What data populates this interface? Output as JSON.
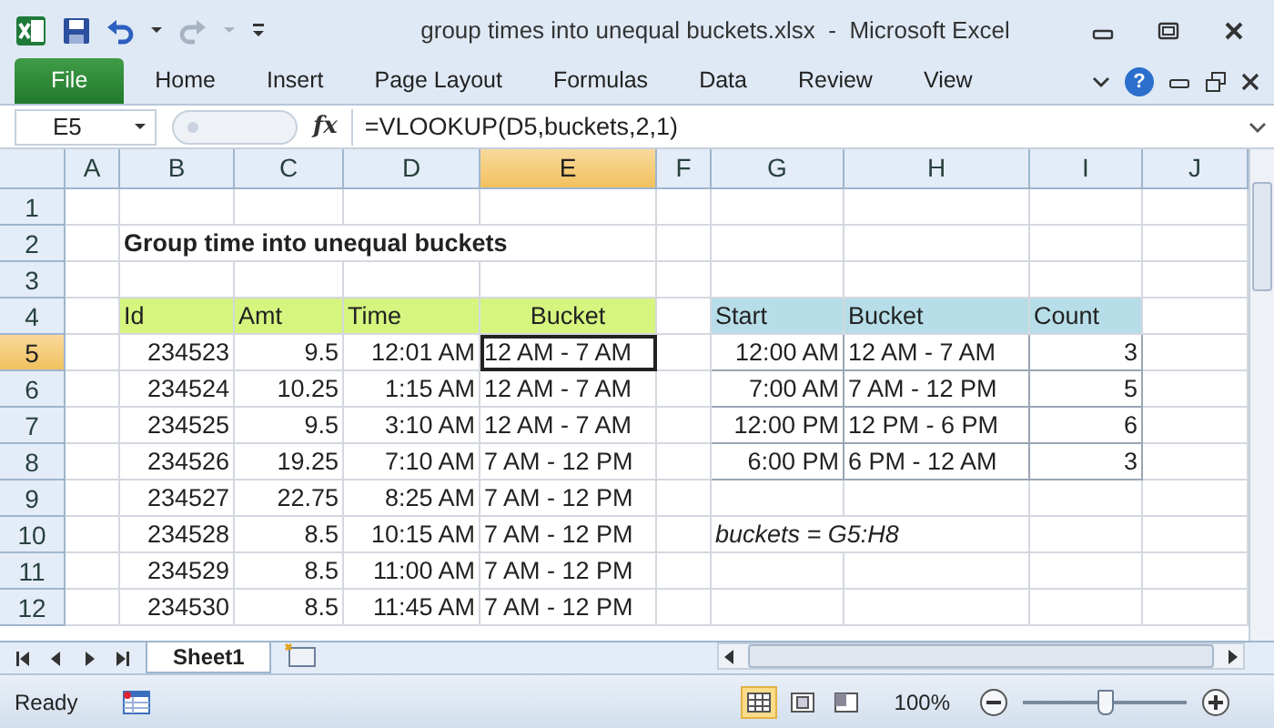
{
  "window": {
    "title": "group times into unequal buckets.xlsx  -  Microsoft Excel"
  },
  "ribbon_tabs": [
    {
      "label": "File",
      "kind": "file",
      "selected": false
    },
    {
      "label": "Home",
      "kind": "tab",
      "selected": false
    },
    {
      "label": "Insert",
      "kind": "tab",
      "selected": false
    },
    {
      "label": "Page Layout",
      "kind": "tab",
      "selected": false
    },
    {
      "label": "Formulas",
      "kind": "tab",
      "selected": false
    },
    {
      "label": "Data",
      "kind": "tab",
      "selected": false
    },
    {
      "label": "Review",
      "kind": "tab",
      "selected": false
    },
    {
      "label": "View",
      "kind": "tab",
      "selected": false
    }
  ],
  "ribbon_help": "?",
  "formula_bar": {
    "name_box": "E5",
    "function_label": "fx",
    "formula": "=VLOOKUP(D5,buckets,2,1)"
  },
  "sheet": {
    "columns": [
      {
        "label": "A",
        "selected": false
      },
      {
        "label": "B",
        "selected": false
      },
      {
        "label": "C",
        "selected": false
      },
      {
        "label": "D",
        "selected": false
      },
      {
        "label": "E",
        "selected": true
      },
      {
        "label": "F",
        "selected": false
      },
      {
        "label": "G",
        "selected": false
      },
      {
        "label": "H",
        "selected": false
      },
      {
        "label": "I",
        "selected": false
      },
      {
        "label": "J",
        "selected": false
      }
    ],
    "rows": [
      {
        "label": "1",
        "selected": false
      },
      {
        "label": "2",
        "selected": false
      },
      {
        "label": "3",
        "selected": false
      },
      {
        "label": "4",
        "selected": false
      },
      {
        "label": "5",
        "selected": true
      },
      {
        "label": "6",
        "selected": false
      },
      {
        "label": "7",
        "selected": false
      },
      {
        "label": "8",
        "selected": false
      },
      {
        "label": "9",
        "selected": false
      },
      {
        "label": "10",
        "selected": false
      },
      {
        "label": "11",
        "selected": false
      },
      {
        "label": "12",
        "selected": false
      }
    ],
    "title": "Group time into unequal buckets",
    "data_table": {
      "columns": [
        "Id",
        "Amt",
        "Time",
        "Bucket"
      ],
      "rows": [
        {
          "cells": [
            "234523",
            "9.5",
            "12:01 AM",
            "12 AM - 7 AM"
          ],
          "selected": true
        },
        {
          "cells": [
            "234524",
            "10.25",
            "1:15 AM",
            "12 AM - 7 AM"
          ],
          "selected": false
        },
        {
          "cells": [
            "234525",
            "9.5",
            "3:10 AM",
            "12 AM - 7 AM"
          ],
          "selected": false
        },
        {
          "cells": [
            "234526",
            "19.25",
            "7:10 AM",
            "7 AM - 12 PM"
          ],
          "selected": false
        },
        {
          "cells": [
            "234527",
            "22.75",
            "8:25 AM",
            "7 AM - 12 PM"
          ],
          "selected": false
        },
        {
          "cells": [
            "234528",
            "8.5",
            "10:15 AM",
            "7 AM - 12 PM"
          ],
          "selected": false
        },
        {
          "cells": [
            "234529",
            "8.5",
            "11:00 AM",
            "7 AM - 12 PM"
          ],
          "selected": false
        },
        {
          "cells": [
            "234530",
            "8.5",
            "11:45 AM",
            "7 AM - 12 PM"
          ],
          "selected": false
        }
      ]
    },
    "lookup_table": {
      "columns": [
        "Start",
        "Bucket",
        "Count"
      ],
      "rows": [
        [
          "12:00 AM",
          "12 AM - 7 AM",
          "3"
        ],
        [
          "7:00 AM",
          "7 AM - 12 PM",
          "5"
        ],
        [
          "12:00 PM",
          "12 PM - 6 PM",
          "6"
        ],
        [
          "6:00 PM",
          "6 PM - 12 AM",
          "3"
        ]
      ]
    },
    "note": "buckets = G5:H8"
  },
  "sheet_tabs": [
    {
      "label": "Sheet1",
      "selected": true
    }
  ],
  "status_bar": {
    "status": "Ready",
    "views": [
      {
        "kind": "normal",
        "selected": true
      },
      {
        "kind": "page_layout",
        "selected": false
      },
      {
        "kind": "page_break",
        "selected": false
      }
    ],
    "zoom": {
      "reading": "100%",
      "level": 0.5
    }
  }
}
